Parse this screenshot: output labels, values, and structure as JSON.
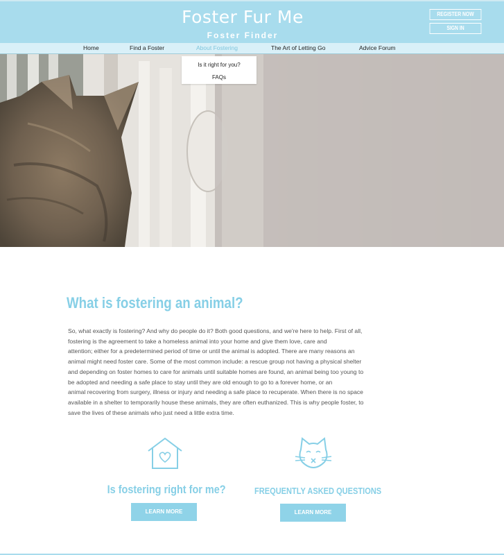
{
  "header": {
    "title": "Foster Fur Me",
    "subtitle": "Foster Finder",
    "register_label": "REGISTER NOW",
    "signin_label": "SIGN IN"
  },
  "nav": {
    "items": [
      {
        "label": "Home"
      },
      {
        "label": "Find a Foster"
      },
      {
        "label": "About Fostering"
      },
      {
        "label": "The Art of Letting Go"
      },
      {
        "label": "Advice Forum"
      }
    ],
    "dropdown": [
      {
        "label": "Is it right for you?"
      },
      {
        "label": "FAQs"
      }
    ]
  },
  "main": {
    "heading": "What is fostering an animal?",
    "paragraph_lines": [
      "So, what exactly is fostering? And why do people do it? Both good questions, and we're here to help. First of all,",
      "fostering is  the agreement to take a homeless animal into your home and give them love, care and",
      "attention; either for a predetermined period of time or until the animal is adopted. There are many reasons an",
      "animal might need foster care. Some of the most common include: a rescue group not having a physical shelter",
      "and depending on foster homes to care for animals until suitable homes are found, an animal being too young to",
      "be adopted and needing a safe place to stay until they are old enough to go to a forever home, or an",
      "animal recovering from surgery, illness or injury and needing a safe place to recuperate. When there is no space",
      "available in a shelter to temporarily house these animals, they are often euthanized. This is why people foster, to",
      "save the lives of these animals who just need a little extra time."
    ]
  },
  "features": [
    {
      "title": "Is fostering right for me?",
      "button_label": "LEARN MORE",
      "icon": "house-heart-icon"
    },
    {
      "title": "FREQUENTLY ASKED QUESTIONS",
      "button_label": "LEARN MORE",
      "icon": "cat-face-icon"
    }
  ],
  "colors": {
    "header_bg": "#a8dced",
    "nav_bg": "#d9f0f8",
    "accent": "#86cfe6",
    "button_bg": "#8fd3e8"
  }
}
